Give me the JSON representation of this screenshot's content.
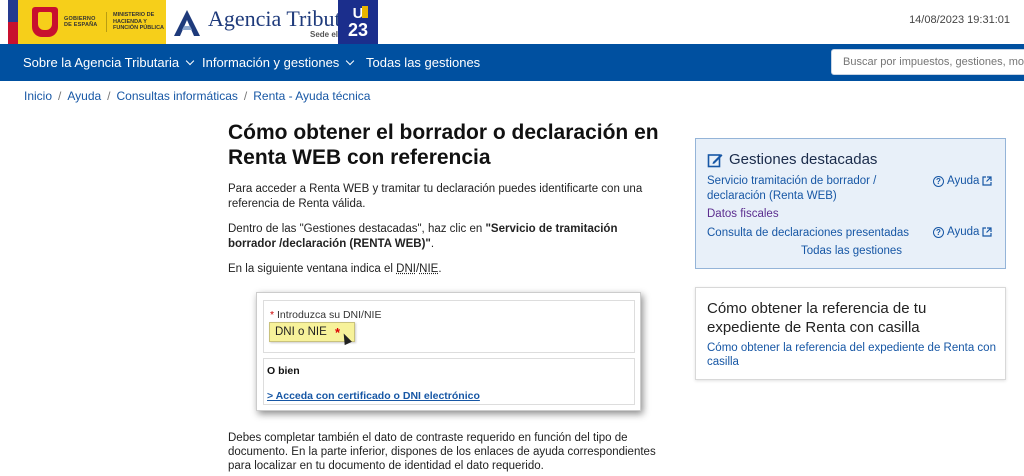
{
  "header": {
    "gov_text": "GOBIERNO DE ESPAÑA",
    "ministry_text": "MINISTERIO DE HACIENDA Y FUNCIÓN PÚBLICA",
    "agency_title": "Agencia Tributaria",
    "agency_subtitle": "Sede electrónica",
    "u23_line1": "U",
    "u23_line2": "23",
    "datetime": "14/08/2023 19:31:01"
  },
  "nav": {
    "items": [
      {
        "label": "Sobre la Agencia Tributaria"
      },
      {
        "label": "Información y gestiones"
      },
      {
        "label": "Todas las gestiones"
      }
    ],
    "search_placeholder": "Buscar por impuestos, gestiones, modelos"
  },
  "breadcrumb": [
    "Inicio",
    "Ayuda",
    "Consultas informáticas",
    "Renta - Ayuda técnica"
  ],
  "main": {
    "title": "Cómo obtener el borrador o declaración en Renta WEB con referencia",
    "p1": "Para acceder a Renta WEB y tramitar tu declaración puedes identificarte con una referencia de Renta válida.",
    "p2_a": "Dentro de las \"Gestiones destacadas\", haz clic en ",
    "p2_b": "\"Servicio de tramitación borrador /declaración (RENTA WEB)\"",
    "p2_c": ".",
    "p3_a": "En la siguiente ventana indica el ",
    "p3_b": "DNI",
    "p3_c": "/",
    "p3_d": "NIE",
    "p3_e": ".",
    "p_bottom": "Debes completar también el dato de contraste requerido en función del tipo de documento. En la parte inferior, dispones de los enlaces de ayuda correspondientes para localizar en tu documento de identidad el dato requerido."
  },
  "screenshot": {
    "label_star": "*",
    "label": "Introduzca su DNI/NIE",
    "input_value": "DNI o NIE",
    "input_star": "*",
    "obien": "O bien",
    "link": "> Acceda con certificado o DNI electrónico"
  },
  "gestiones": {
    "title": "Gestiones destacadas",
    "link1": "Servicio tramitación de borrador / declaración (Renta WEB)",
    "help1": "Ayuda",
    "link2": "Datos fiscales",
    "link3": "Consulta de declaraciones presentadas",
    "help3": "Ayuda",
    "all": "Todas las gestiones"
  },
  "related": {
    "title": "Cómo obtener la referencia de tu expediente de Renta con casilla",
    "link": "Cómo obtener la referencia del expediente de Renta con casilla"
  },
  "colors": {
    "nav_bg": "#0050a0",
    "link": "#1757a5",
    "visited": "#5b2d8f",
    "card_bg": "#e8f0f9"
  }
}
